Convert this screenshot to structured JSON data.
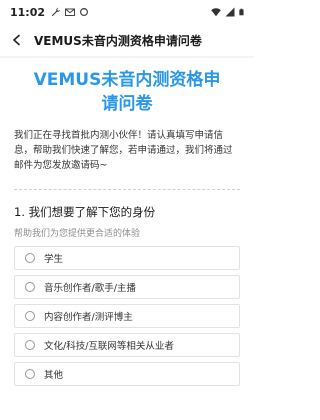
{
  "status_bar": {
    "time": "11:02"
  },
  "app_bar": {
    "title": "VEMUS未音内测资格申请问卷"
  },
  "survey": {
    "hero_title": "VEMUS未音内测资格申请问卷",
    "intro": "我们正在寻找首批内测小伙伴！请认真填写申请信息，帮助我们快速了解您，若申请通过，我们将通过邮件为您发放邀请码~",
    "question": {
      "title": "1. 我们想要了解下您的身份",
      "hint": "帮助我们为您提供更合适的体验",
      "options": [
        {
          "label": "学生"
        },
        {
          "label": "音乐创作者/歌手/主播"
        },
        {
          "label": "内容创作者/测评博主"
        },
        {
          "label": "文化/科技/互联网等相关从业者"
        },
        {
          "label": "其他"
        }
      ]
    }
  },
  "colors": {
    "accent": "#2a97e8",
    "text_primary": "#1a1a1a",
    "text_hint": "#8e8e8e",
    "option_border": "#e3e3e3"
  }
}
